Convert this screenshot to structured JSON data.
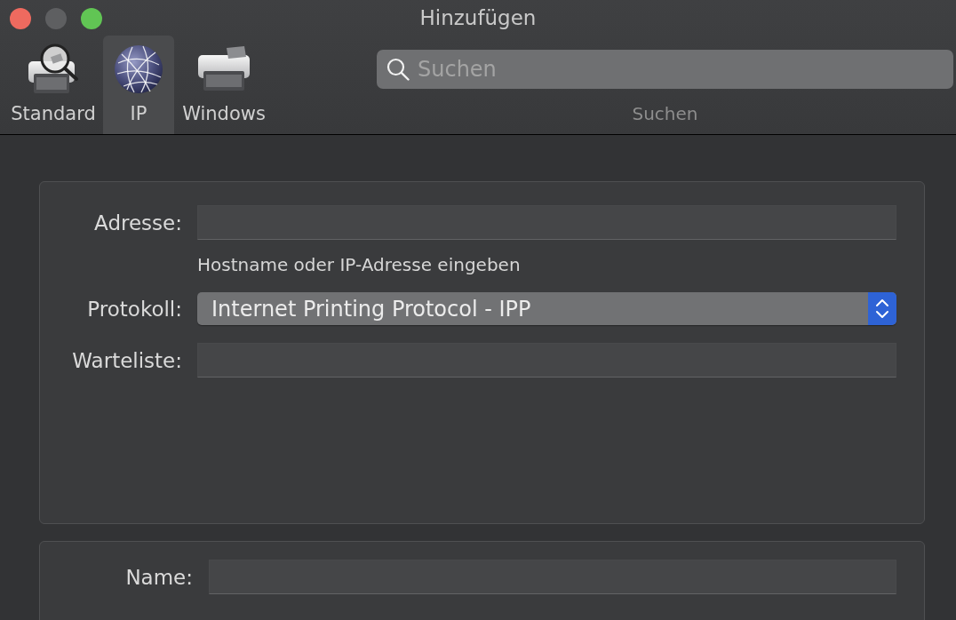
{
  "window": {
    "title": "Hinzufügen",
    "controls": [
      {
        "kind": "close",
        "disabled": false
      },
      {
        "kind": "minimize",
        "disabled": true
      },
      {
        "kind": "zoom",
        "disabled": false
      }
    ]
  },
  "toolbar": {
    "tabs": [
      {
        "kind": "standard",
        "label": "Standard",
        "selected": false
      },
      {
        "kind": "ip",
        "label": "IP",
        "selected": true
      },
      {
        "kind": "windows",
        "label": "Windows",
        "selected": false
      }
    ],
    "search": {
      "placeholder": "Suchen",
      "caption": "Suchen"
    }
  },
  "connection": {
    "fields": [
      {
        "kind": "text",
        "label": "Adresse:",
        "hint": "Hostname oder IP-Adresse eingeben"
      },
      {
        "kind": "popup",
        "label": "Protokoll:",
        "value": "Internet Printing Protocol - IPP"
      },
      {
        "kind": "text",
        "label": "Warteliste:"
      }
    ]
  },
  "details": {
    "fields": [
      {
        "kind": "text",
        "label": "Name:"
      }
    ]
  }
}
